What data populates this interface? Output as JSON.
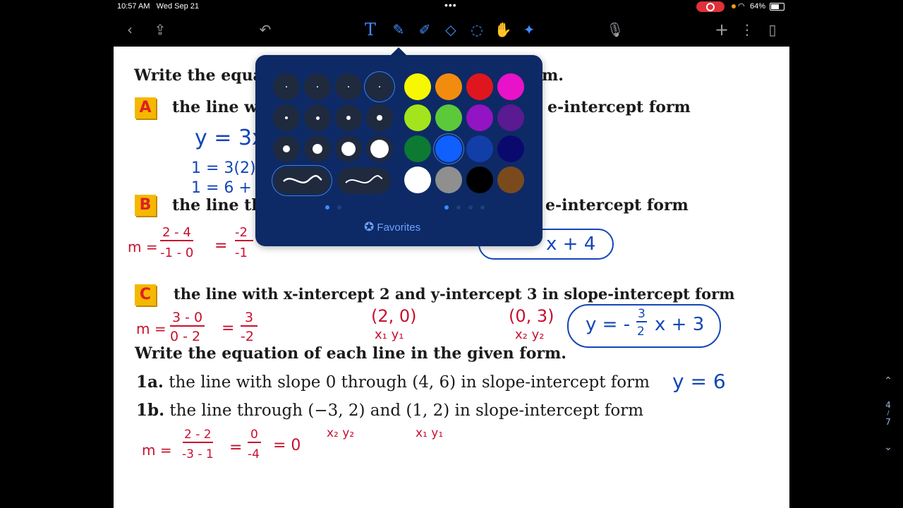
{
  "status": {
    "time": "10:57 AM",
    "date": "Wed Sep 21",
    "battery": "64%",
    "dots": "•••"
  },
  "toolbar": {
    "icons": [
      "back-icon",
      "share-icon",
      "undo-icon",
      "text-tool-icon",
      "pen-icon",
      "highlighter-icon",
      "eraser-icon",
      "lasso-icon",
      "element-icon",
      "laser-icon",
      "mic-icon",
      "add-icon",
      "more-icon",
      "pages-icon"
    ]
  },
  "worksheet": {
    "header1": "Write the equa",
    "header1_end": "m.",
    "A": {
      "badge": "A",
      "text_start": "the line w",
      "text_end": "e-intercept form"
    },
    "B": {
      "badge": "B",
      "text_start": "the line th",
      "text_end": "e-intercept form"
    },
    "C": {
      "badge": "C",
      "text": "the line with x-intercept 2 and y-intercept 3 in slope-intercept form"
    },
    "header2": "Write the equation of each line in the given form.",
    "q1a": {
      "num": "1a.",
      "text": "the line with slope 0 through (4, 6) in slope-intercept form"
    },
    "q1b": {
      "num": "1b.",
      "text": "the line through (−3, 2) and (1, 2) in slope-intercept form"
    }
  },
  "handwriting": {
    "a1": "y = 3x",
    "a2": "1 = 3(2)",
    "a3": "1 = 6 +",
    "b_m": "m =",
    "b_num": "2 - 4",
    "b_den": "-1 - 0",
    "b_eq": "=",
    "b_num2": "-2",
    "b_den2": "-1",
    "b_ans": "x + 4",
    "c_m": "m =",
    "c_num": "3 - 0",
    "c_den": "0 - 2",
    "c_eq": "=",
    "c_num2": "3",
    "c_den2": "-2",
    "c_p1": "(2, 0)",
    "c_p1lab": "x₁  y₁",
    "c_p2": "(0, 3)",
    "c_p2lab": "x₂  y₂",
    "c_ans_left": "y = -",
    "c_ans_num": "3",
    "c_ans_den": "2",
    "c_ans_right": "x + 3",
    "q1a_ans": "y = 6",
    "q1b_m": "m =",
    "q1b_num": "2 - 2",
    "q1b_den": "-3 - 1",
    "q1b_eq": "=",
    "q1b_num2": "0",
    "q1b_den2": "-4",
    "q1b_res": "= 0",
    "q1b_lab1": "x₂  y₂",
    "q1b_lab2": "x₁  y₁"
  },
  "scroll": {
    "page": "4",
    "sep": "/",
    "total": "7"
  },
  "popover": {
    "favorites": "Favorites",
    "colors": [
      "#f7f700",
      "#f28c0f",
      "#e0161e",
      "#e812c9",
      "#a3e41c",
      "#5cc93b",
      "#9214c2",
      "#5a1a91",
      "#0c7a32",
      "#0f60ff",
      "#123ea8",
      "#0a0a6e",
      "#ffffff",
      "#8f8f8f",
      "#000000",
      "#7a4a1d"
    ],
    "selected_color": "#0f60ff"
  }
}
